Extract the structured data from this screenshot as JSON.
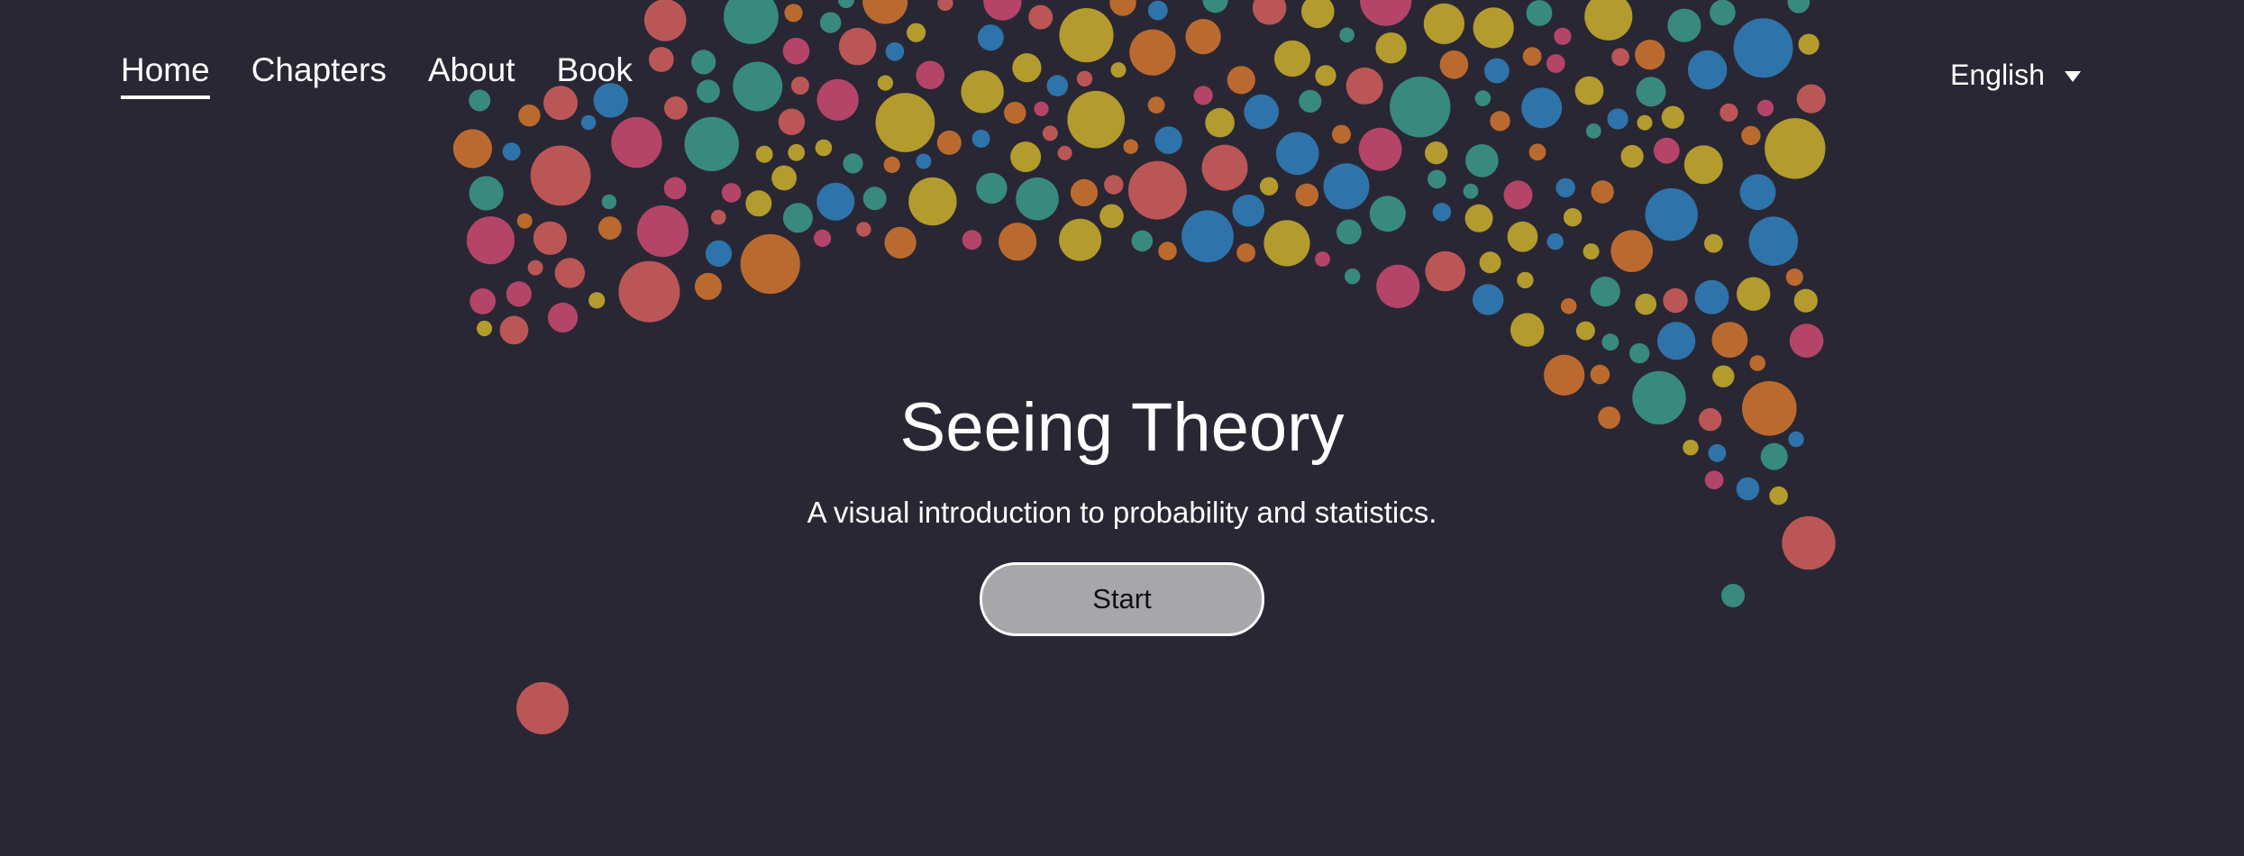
{
  "nav": {
    "items": [
      {
        "label": "Home",
        "active": true
      },
      {
        "label": "Chapters",
        "active": false
      },
      {
        "label": "About",
        "active": false
      },
      {
        "label": "Book",
        "active": false
      }
    ]
  },
  "language": {
    "selected": "English",
    "icon": "caret-down-icon"
  },
  "hero": {
    "title": "Seeing Theory",
    "subtitle": "A visual introduction to probability and statistics.",
    "start_label": "Start"
  },
  "colors": {
    "background": "#2a2734",
    "bubble_red": "#c85a5a",
    "bubble_orange": "#c8702f",
    "bubble_yellow": "#bfa52e",
    "bubble_teal": "#3a9284",
    "bubble_blue": "#2f7bb5",
    "bubble_pink": "#c0486c",
    "button_fill": "#a7a6ab"
  }
}
